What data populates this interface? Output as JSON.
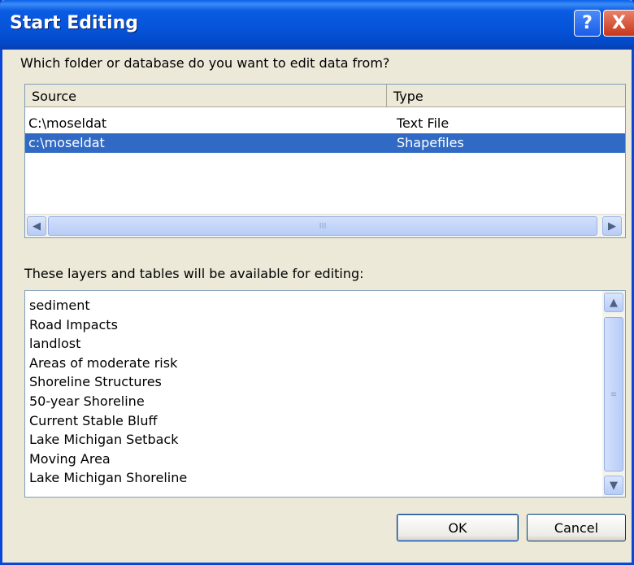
{
  "window": {
    "title": "Start Editing"
  },
  "titlebar_buttons": {
    "help": "?",
    "close": "X"
  },
  "prompt": "Which folder or database do you want to edit data from?",
  "sources": {
    "columns": [
      "Source",
      "Type"
    ],
    "rows": [
      {
        "source": "C:\\moseldat",
        "type": "Text File",
        "selected": false
      },
      {
        "source": "c:\\moseldat",
        "type": "Shapefiles",
        "selected": true
      }
    ]
  },
  "layers_label": "These layers and tables will be available for editing:",
  "layers": [
    "sediment",
    "Road Impacts",
    "landlost",
    "Areas of moderate risk",
    "Shoreline Structures",
    "50-year Shoreline",
    "Current Stable Bluff",
    "Lake Michigan Setback",
    "Moving Area",
    "Lake Michigan Shoreline"
  ],
  "buttons": {
    "ok": "OK",
    "cancel": "Cancel"
  },
  "icons": {
    "left": "◀",
    "right": "▶",
    "up": "▲",
    "down": "▼",
    "grip": "III",
    "grip_v": "≡"
  },
  "colors": {
    "selection": "#316ac5",
    "titlebar": "#0453d8"
  }
}
